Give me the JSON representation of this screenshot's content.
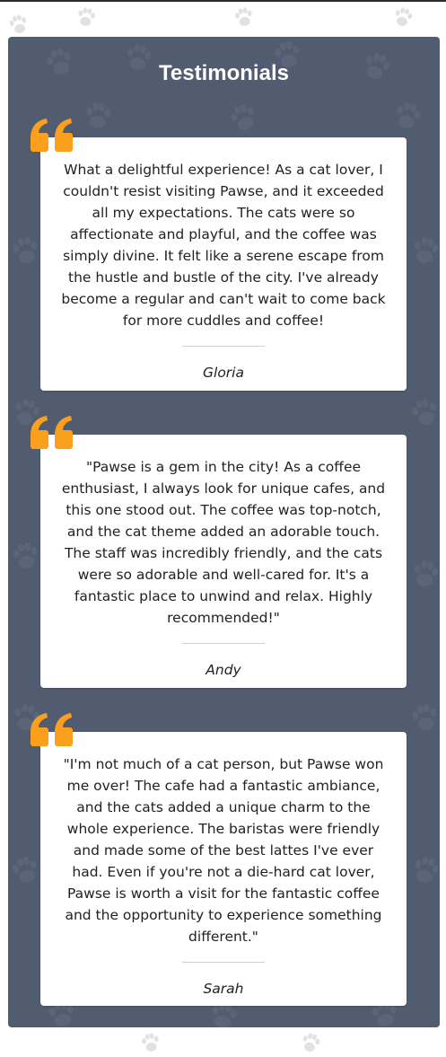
{
  "section": {
    "title": "Testimonials"
  },
  "colors": {
    "panel_bg": "#525c70",
    "quote_accent": "#fba01c",
    "card_bg": "#ffffff"
  },
  "testimonials": [
    {
      "text": "What a delightful experience! As a cat lover, I couldn't resist visiting Pawse, and it exceeded all my expectations. The cats were so affectionate and playful, and the coffee was simply divine. It felt like a serene escape from the hustle and bustle of the city. I've already become a regular and can't wait to come back for more cuddles and coffee!",
      "author": "Gloria"
    },
    {
      "text": "\"Pawse is a gem in the city! As a coffee enthusiast, I always look for unique cafes, and this one stood out. The coffee was top-notch, and the cat theme added an adorable touch. The staff was incredibly friendly, and the cats were so adorable and well-cared for. It's a fantastic place to unwind and relax. Highly recommended!\"",
      "author": "Andy"
    },
    {
      "text": "\"I'm not much of a cat person, but Pawse won me over! The cafe had a fantastic ambiance, and the cats added a unique charm to the whole experience. The baristas were friendly and made some of the best lattes I've ever had. Even if you're not a die-hard cat lover, Pawse is worth a visit for the fantastic coffee and the opportunity to experience something different.\"",
      "author": "Sarah"
    }
  ]
}
